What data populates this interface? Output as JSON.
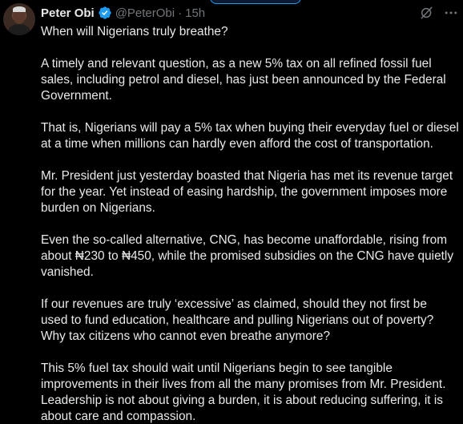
{
  "tweet": {
    "display_name": "Peter Obi",
    "handle": "@PeterObi",
    "separator": "·",
    "time": "15h",
    "paragraphs": [
      "When will Nigerians truly breathe?",
      "A timely and relevant question, as a new 5% tax on all refined fossil fuel\nsales, including petrol and diesel, has just been announced by the Federal\nGovernment.",
      "That is, Nigerians will pay a 5% tax when buying their everyday fuel or diesel\nat a time when millions can hardly even afford the cost of transportation.",
      "Mr. President just yesterday boasted that Nigeria has met its revenue target\nfor the year. Yet instead of easing hardship, the government imposes more\nburden on Nigerians.",
      "Even the so-called alternative, CNG, has become unaffordable, rising from\nabout ₦230 to ₦450, while the promised subsidies on the CNG have quietly\nvanished.",
      "If our revenues are truly ‘excessive’ as claimed, should they not first be\nused to fund education, healthcare and pulling Nigerians out of poverty?\nWhy tax citizens who cannot even breathe anymore?",
      "This 5% fuel tax should wait until Nigerians begin to see tangible\nimprovements in their lives from all the many promises from Mr. President.\nLeadership is not about giving a burden, it is about reducing suffering, it is\nabout care and compassion."
    ]
  },
  "colors": {
    "background": "#000000",
    "text": "#e7e9ea",
    "muted": "#71767b",
    "verified": "#1d9bf0"
  },
  "icons": {
    "verified": "verified-badge-icon",
    "grok": "grok-icon",
    "more": "more-options-icon"
  }
}
